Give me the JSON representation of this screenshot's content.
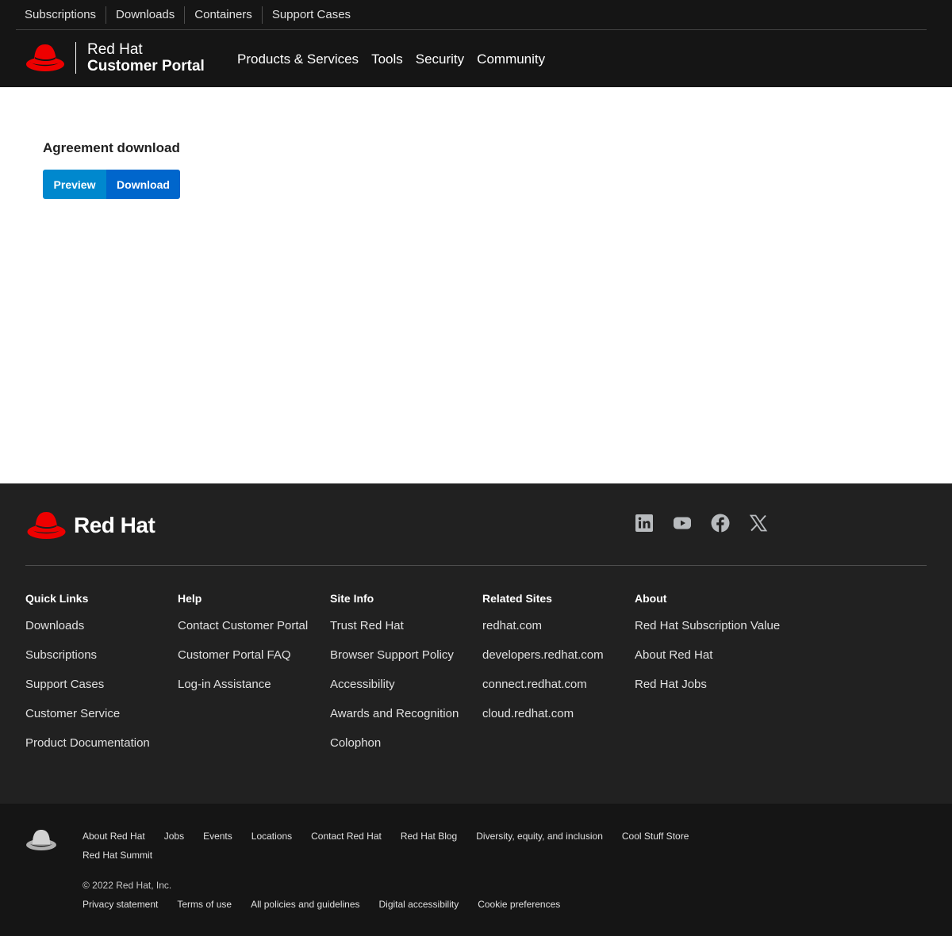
{
  "header": {
    "utility_nav": [
      "Subscriptions",
      "Downloads",
      "Containers",
      "Support Cases"
    ],
    "brand": {
      "line1": "Red Hat",
      "line2": "Customer Portal"
    },
    "main_nav": [
      "Products & Services",
      "Tools",
      "Security",
      "Community"
    ]
  },
  "main": {
    "heading": "Agreement download",
    "preview_label": "Preview",
    "download_label": "Download"
  },
  "footer": {
    "wordmark": "Red Hat",
    "social_icons": [
      "linkedin-icon",
      "youtube-icon",
      "facebook-icon",
      "x-icon"
    ],
    "columns": [
      {
        "title": "Quick Links",
        "links": [
          "Downloads",
          "Subscriptions",
          "Support Cases",
          "Customer Service",
          "Product Documentation"
        ]
      },
      {
        "title": "Help",
        "links": [
          "Contact Customer Portal",
          "Customer Portal FAQ",
          "Log-in Assistance"
        ]
      },
      {
        "title": "Site Info",
        "links": [
          "Trust Red Hat",
          "Browser Support Policy",
          "Accessibility",
          "Awards and Recognition",
          "Colophon"
        ]
      },
      {
        "title": "Related Sites",
        "links": [
          "redhat.com",
          "developers.redhat.com",
          "connect.redhat.com",
          "cloud.redhat.com"
        ]
      },
      {
        "title": "About",
        "links": [
          "Red Hat Subscription Value",
          "About Red Hat",
          "Red Hat Jobs"
        ]
      }
    ]
  },
  "bottom_bar": {
    "links": [
      "About Red Hat",
      "Jobs",
      "Events",
      "Locations",
      "Contact Red Hat",
      "Red Hat Blog",
      "Diversity, equity, and inclusion",
      "Cool Stuff Store",
      "Red Hat Summit"
    ],
    "copyright": "© 2022 Red Hat, Inc.",
    "legal_links": [
      "Privacy statement",
      "Terms of use",
      "All policies and guidelines",
      "Digital accessibility",
      "Cookie preferences"
    ]
  },
  "colors": {
    "header_bg": "#151515",
    "footer_bg": "#212121",
    "brand_red": "#ee0000",
    "preview_blue": "#0088ce",
    "download_blue": "#0066cc"
  }
}
